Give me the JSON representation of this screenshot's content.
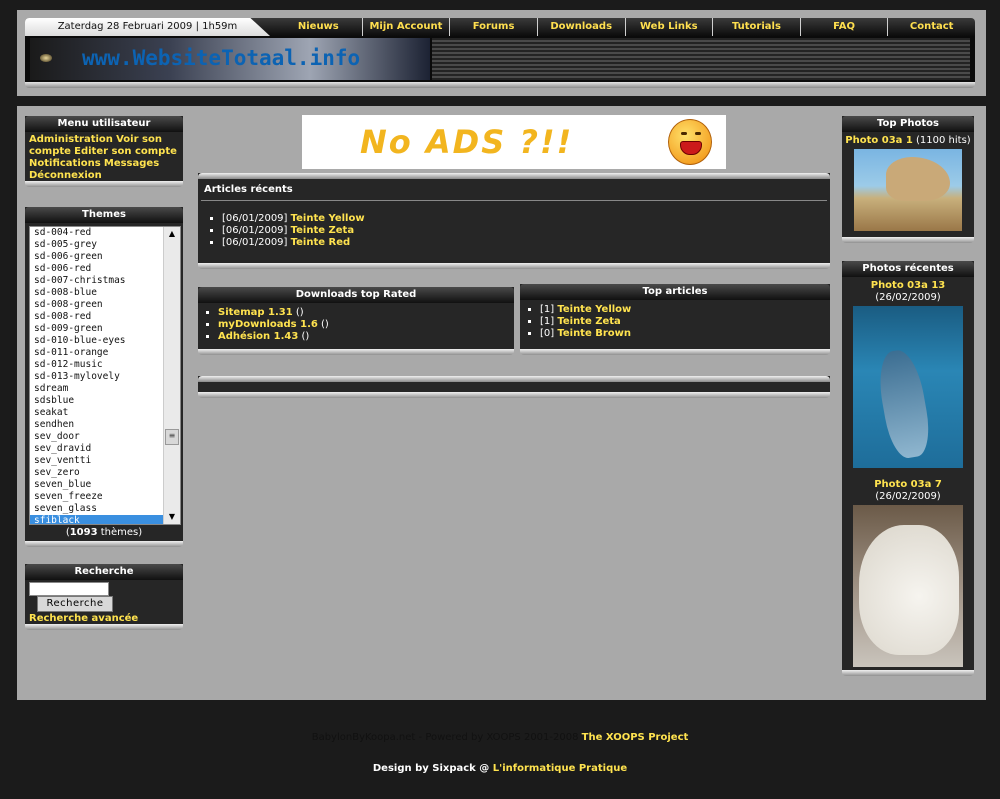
{
  "header": {
    "date": "Zaterdag 28 Februari 2009 | 1h59m",
    "nav": [
      "Nieuws",
      "Mijn Account",
      "Forums",
      "Downloads",
      "Web Links",
      "Tutorials",
      "FAQ",
      "Contact"
    ],
    "logo_text": "www.WebsiteTotaal.info"
  },
  "user_menu": {
    "title": "Menu utilisateur",
    "links": [
      "Administration",
      "Voir son compte",
      "Editer son compte",
      "Notifications",
      "Messages",
      "Déconnexion"
    ]
  },
  "themes": {
    "title": "Themes",
    "items": [
      "sd-004-red",
      "sd-005-grey",
      "sd-006-green",
      "sd-006-red",
      "sd-007-christmas",
      "sd-008-blue",
      "sd-008-green",
      "sd-008-red",
      "sd-009-green",
      "sd-010-blue-eyes",
      "sd-011-orange",
      "sd-012-music",
      "sd-013-mylovely",
      "sdream",
      "sdsblue",
      "seakat",
      "sendhen",
      "sev_door",
      "sev_dravid",
      "sev_ventti",
      "sev_zero",
      "seven_blue",
      "seven_freeze",
      "seven_glass",
      "sfiblack"
    ],
    "selected": "sfiblack",
    "count": "1093",
    "count_suffix": " thèmes"
  },
  "search": {
    "title": "Recherche",
    "button": "Recherche",
    "advanced": "Recherche avancée"
  },
  "ad": {
    "text": "No ADS ?!!"
  },
  "recent_articles": {
    "title": "Articles récents",
    "items": [
      {
        "date": "[06/01/2009]",
        "title": "Teinte Yellow"
      },
      {
        "date": "[06/01/2009]",
        "title": "Teinte Zeta"
      },
      {
        "date": "[06/01/2009]",
        "title": "Teinte Red"
      }
    ]
  },
  "downloads_top": {
    "title": "Downloads top Rated",
    "items": [
      {
        "name": "Sitemap 1.31",
        "extra": "()"
      },
      {
        "name": "myDownloads 1.6",
        "extra": "()"
      },
      {
        "name": "Adhésion 1.43",
        "extra": "()"
      }
    ]
  },
  "top_articles": {
    "title": "Top articles",
    "items": [
      {
        "count": "[1]",
        "title": "Teinte Yellow"
      },
      {
        "count": "[1]",
        "title": "Teinte Zeta"
      },
      {
        "count": "[0]",
        "title": "Teinte Brown"
      }
    ]
  },
  "top_photos": {
    "title": "Top Photos",
    "caption_link": "Photo 03a 1",
    "caption_extra": "(1100 hits)"
  },
  "recent_photos": {
    "title": "Photos récentes",
    "photos": [
      {
        "link": "Photo 03a 13",
        "extra": "(26/02/2009)"
      },
      {
        "link": "Photo 03a 7",
        "extra": "(26/02/2009)"
      }
    ]
  },
  "footer": {
    "powered": "BabylonByKoopa.net - Powered by XOOPS 2001-2008 ",
    "powered_link": "The XOOPS Project",
    "design": "Design by Sixpack @ ",
    "design_link": "L'informatique Pratique"
  }
}
